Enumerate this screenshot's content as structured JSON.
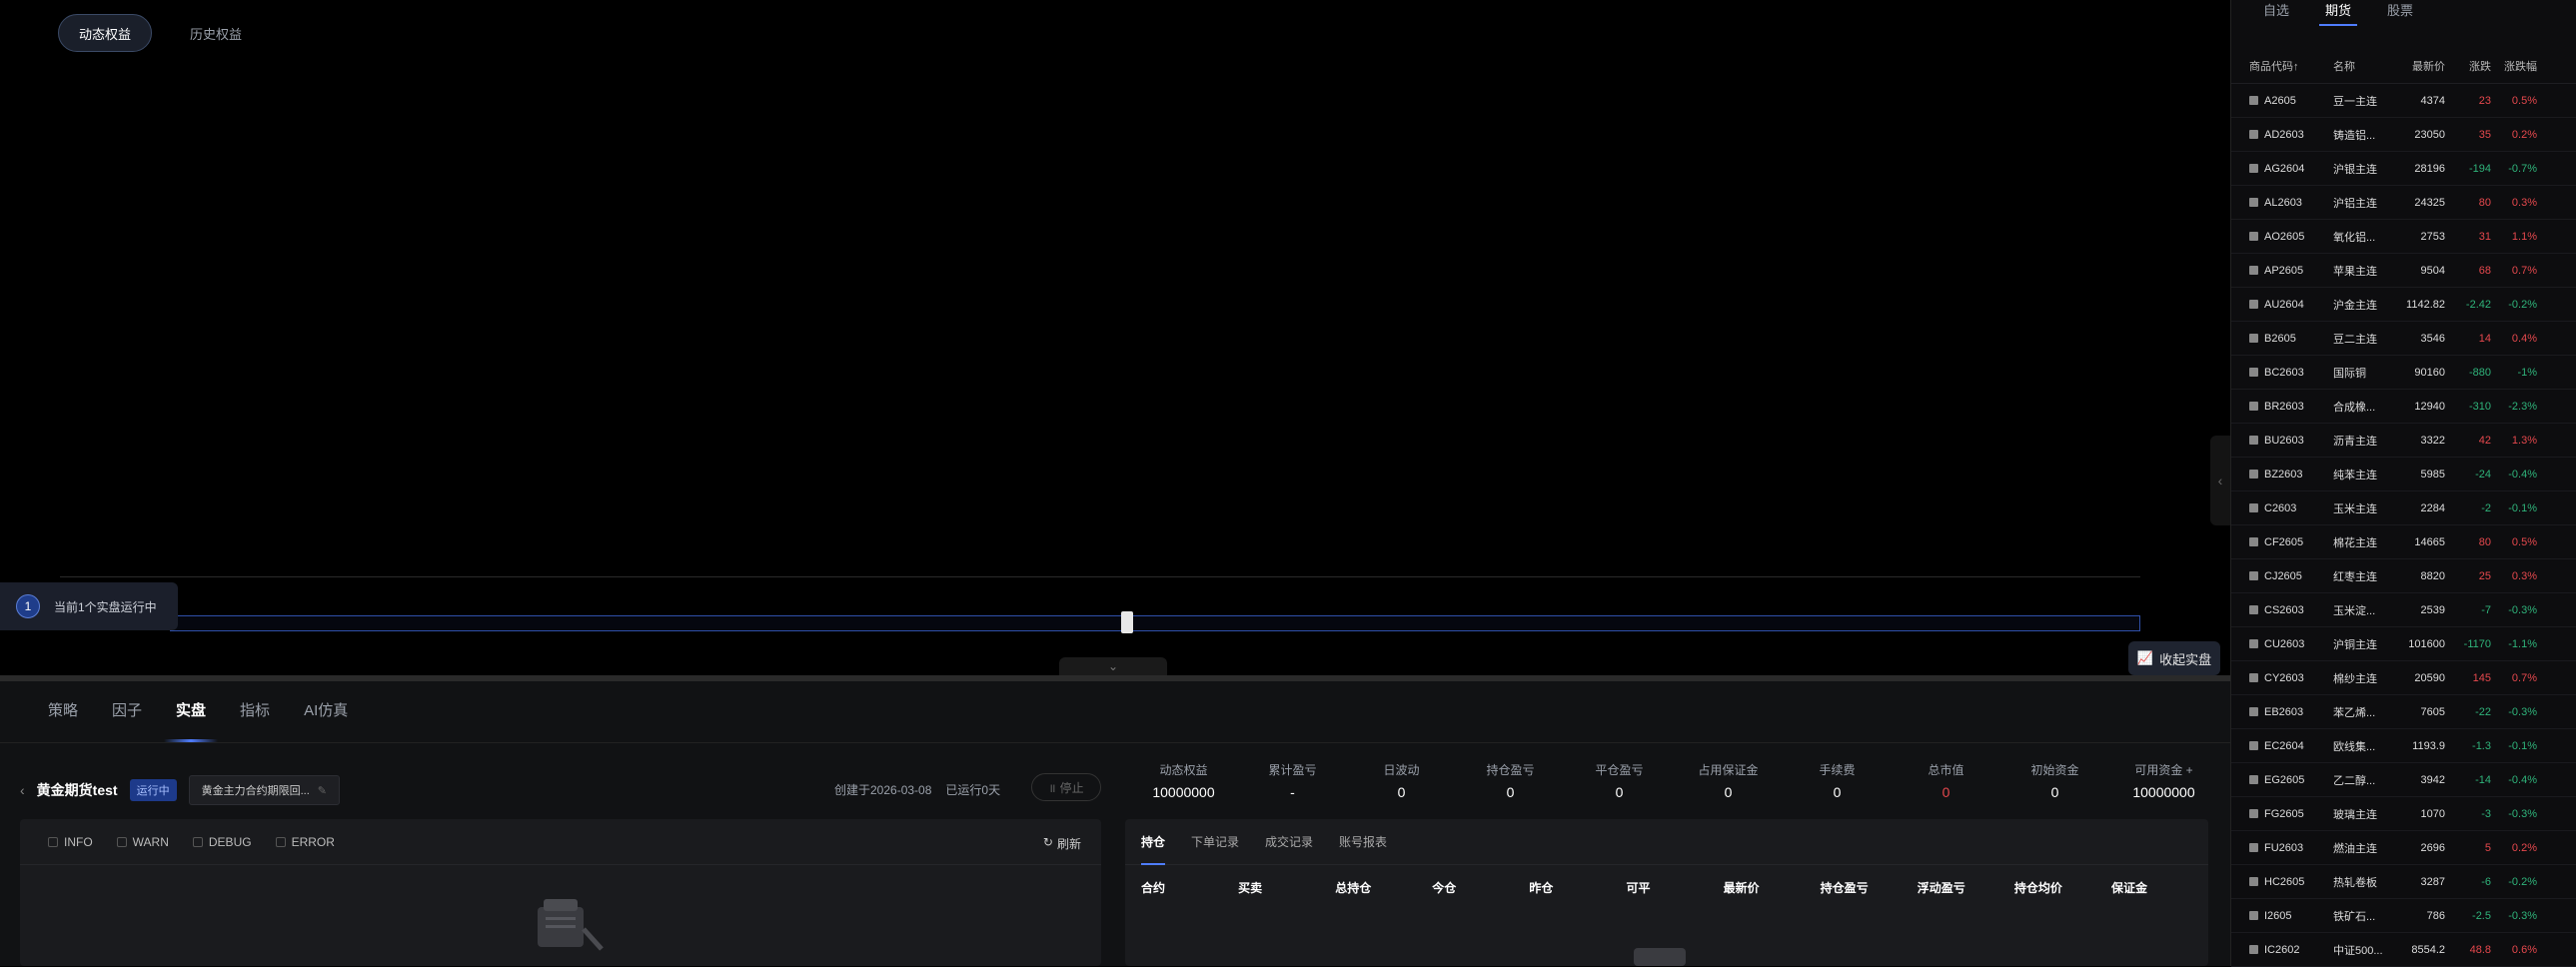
{
  "top_tabs": [
    "动态权益",
    "历史权益"
  ],
  "running": {
    "num": "1",
    "text": "当前1个实盘运行中"
  },
  "collapse_btn": "收起实盘",
  "bottom_tabs": [
    "策略",
    "因子",
    "实盘",
    "指标",
    "AI仿真"
  ],
  "strategy": {
    "name": "黄金期货test",
    "status": "运行中",
    "contract": "黄金主力合约期限回...",
    "created": "创建于2026-03-08",
    "running_days": "已运行0天",
    "stop": "停止"
  },
  "metrics": [
    {
      "label": "动态权益",
      "value": "10000000"
    },
    {
      "label": "累计盈亏",
      "value": "-"
    },
    {
      "label": "日波动",
      "value": "0"
    },
    {
      "label": "持仓盈亏",
      "value": "0"
    },
    {
      "label": "平仓盈亏",
      "value": "0"
    },
    {
      "label": "占用保证金",
      "value": "0"
    },
    {
      "label": "手续费",
      "value": "0"
    },
    {
      "label": "总市值",
      "value": "0",
      "red": true
    },
    {
      "label": "初始资金",
      "value": "0"
    },
    {
      "label": "可用资金 +",
      "value": "10000000"
    }
  ],
  "log": {
    "levels": [
      "INFO",
      "WARN",
      "DEBUG",
      "ERROR"
    ],
    "refresh": "刷新"
  },
  "pos": {
    "tabs": [
      "持仓",
      "下单记录",
      "成交记录",
      "账号报表"
    ],
    "cols": [
      "合约",
      "买卖",
      "总持仓",
      "今仓",
      "昨仓",
      "可平",
      "最新价",
      "持仓盈亏",
      "浮动盈亏",
      "持仓均价",
      "保证金"
    ]
  },
  "watch": {
    "tabs": [
      "自选",
      "期货",
      "股票"
    ],
    "head": [
      "商品代码↑",
      "名称",
      "最新价",
      "涨跌",
      "涨跌幅"
    ],
    "rows": [
      [
        "A2605",
        "豆一主连",
        "4374",
        "23",
        "0.5%"
      ],
      [
        "AD2603",
        "铸造铝...",
        "23050",
        "35",
        "0.2%"
      ],
      [
        "AG2604",
        "沪银主连",
        "28196",
        "-194",
        "-0.7%"
      ],
      [
        "AL2603",
        "沪铝主连",
        "24325",
        "80",
        "0.3%"
      ],
      [
        "AO2605",
        "氧化铝...",
        "2753",
        "31",
        "1.1%"
      ],
      [
        "AP2605",
        "苹果主连",
        "9504",
        "68",
        "0.7%"
      ],
      [
        "AU2604",
        "沪金主连",
        "1142.82",
        "-2.42",
        "-0.2%"
      ],
      [
        "B2605",
        "豆二主连",
        "3546",
        "14",
        "0.4%"
      ],
      [
        "BC2603",
        "国际铜",
        "90160",
        "-880",
        "-1%"
      ],
      [
        "BR2603",
        "合成橡...",
        "12940",
        "-310",
        "-2.3%"
      ],
      [
        "BU2603",
        "沥青主连",
        "3322",
        "42",
        "1.3%"
      ],
      [
        "BZ2603",
        "纯苯主连",
        "5985",
        "-24",
        "-0.4%"
      ],
      [
        "C2603",
        "玉米主连",
        "2284",
        "-2",
        "-0.1%"
      ],
      [
        "CF2605",
        "棉花主连",
        "14665",
        "80",
        "0.5%"
      ],
      [
        "CJ2605",
        "红枣主连",
        "8820",
        "25",
        "0.3%"
      ],
      [
        "CS2603",
        "玉米淀...",
        "2539",
        "-7",
        "-0.3%"
      ],
      [
        "CU2603",
        "沪铜主连",
        "101600",
        "-1170",
        "-1.1%"
      ],
      [
        "CY2603",
        "棉纱主连",
        "20590",
        "145",
        "0.7%"
      ],
      [
        "EB2603",
        "苯乙烯...",
        "7605",
        "-22",
        "-0.3%"
      ],
      [
        "EC2604",
        "欧线集...",
        "1193.9",
        "-1.3",
        "-0.1%"
      ],
      [
        "EG2605",
        "乙二醇...",
        "3942",
        "-14",
        "-0.4%"
      ],
      [
        "FG2605",
        "玻璃主连",
        "1070",
        "-3",
        "-0.3%"
      ],
      [
        "FU2603",
        "燃油主连",
        "2696",
        "5",
        "0.2%"
      ],
      [
        "HC2605",
        "热轧卷板",
        "3287",
        "-6",
        "-0.2%"
      ],
      [
        "I2605",
        "铁矿石...",
        "786",
        "-2.5",
        "-0.3%"
      ],
      [
        "IC2602",
        "中证500...",
        "8554.2",
        "48.8",
        "0.6%"
      ]
    ]
  }
}
